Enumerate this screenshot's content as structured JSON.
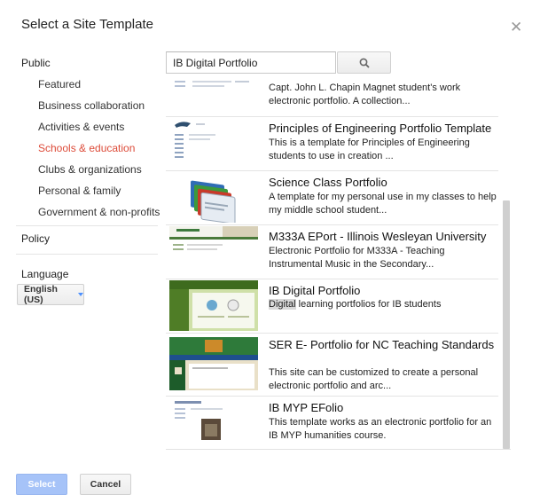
{
  "dialog": {
    "title": "Select a Site Template"
  },
  "sidebar": {
    "public_heading": "Public",
    "categories": [
      {
        "label": "Featured"
      },
      {
        "label": "Business collaboration"
      },
      {
        "label": "Activities & events"
      },
      {
        "label": "Schools & education",
        "active": true
      },
      {
        "label": "Clubs & organizations"
      },
      {
        "label": "Personal & family"
      },
      {
        "label": "Government & non-profits"
      }
    ],
    "policy_heading": "Policy",
    "language_heading": "Language",
    "language_value": "English (US)"
  },
  "search": {
    "value": "IB Digital Portfolio"
  },
  "results": [
    {
      "title": "",
      "desc_before": "Capt. John L. Chapin Magnet student's work electronic portfolio. A collection...",
      "desc_highlight": "",
      "desc_after": ""
    },
    {
      "title": "Principles of Engineering Portfolio Template",
      "desc_before": "This is a template for Principles of Engineering students to use in creation ...",
      "desc_highlight": "",
      "desc_after": ""
    },
    {
      "title": "Science Class Portfolio",
      "desc_before": "A template for my personal use in my classes to help my middle school student...",
      "desc_highlight": "",
      "desc_after": ""
    },
    {
      "title": "M333A EPort - Illinois Wesleyan University",
      "desc_before": "Electronic Portfolio for M333A - Teaching Instrumental Music in the Secondary...",
      "desc_highlight": "",
      "desc_after": ""
    },
    {
      "title": "IB Digital Portfolio",
      "desc_before": "",
      "desc_highlight": "Digital",
      "desc_after": " learning portfolios for IB students"
    },
    {
      "title": "SER E- Portfolio for NC Teaching Standards",
      "desc_before": "This site can be customized to create a personal electronic portfolio and arc...",
      "desc_highlight": "",
      "desc_after": ""
    },
    {
      "title": "IB MYP EFolio",
      "desc_before": "This template works as an electronic portfolio for an IB MYP humanities course.",
      "desc_highlight": "",
      "desc_after": ""
    }
  ],
  "buttons": {
    "select": "Select",
    "cancel": "Cancel"
  },
  "icons": {
    "close": "close-icon",
    "search": "search-icon",
    "dropdown": "chevron-down-icon"
  },
  "colors": {
    "active_category": "#dd4b39",
    "select_button": "#a6c3f8",
    "dropdown_caret": "#4d90fe"
  }
}
